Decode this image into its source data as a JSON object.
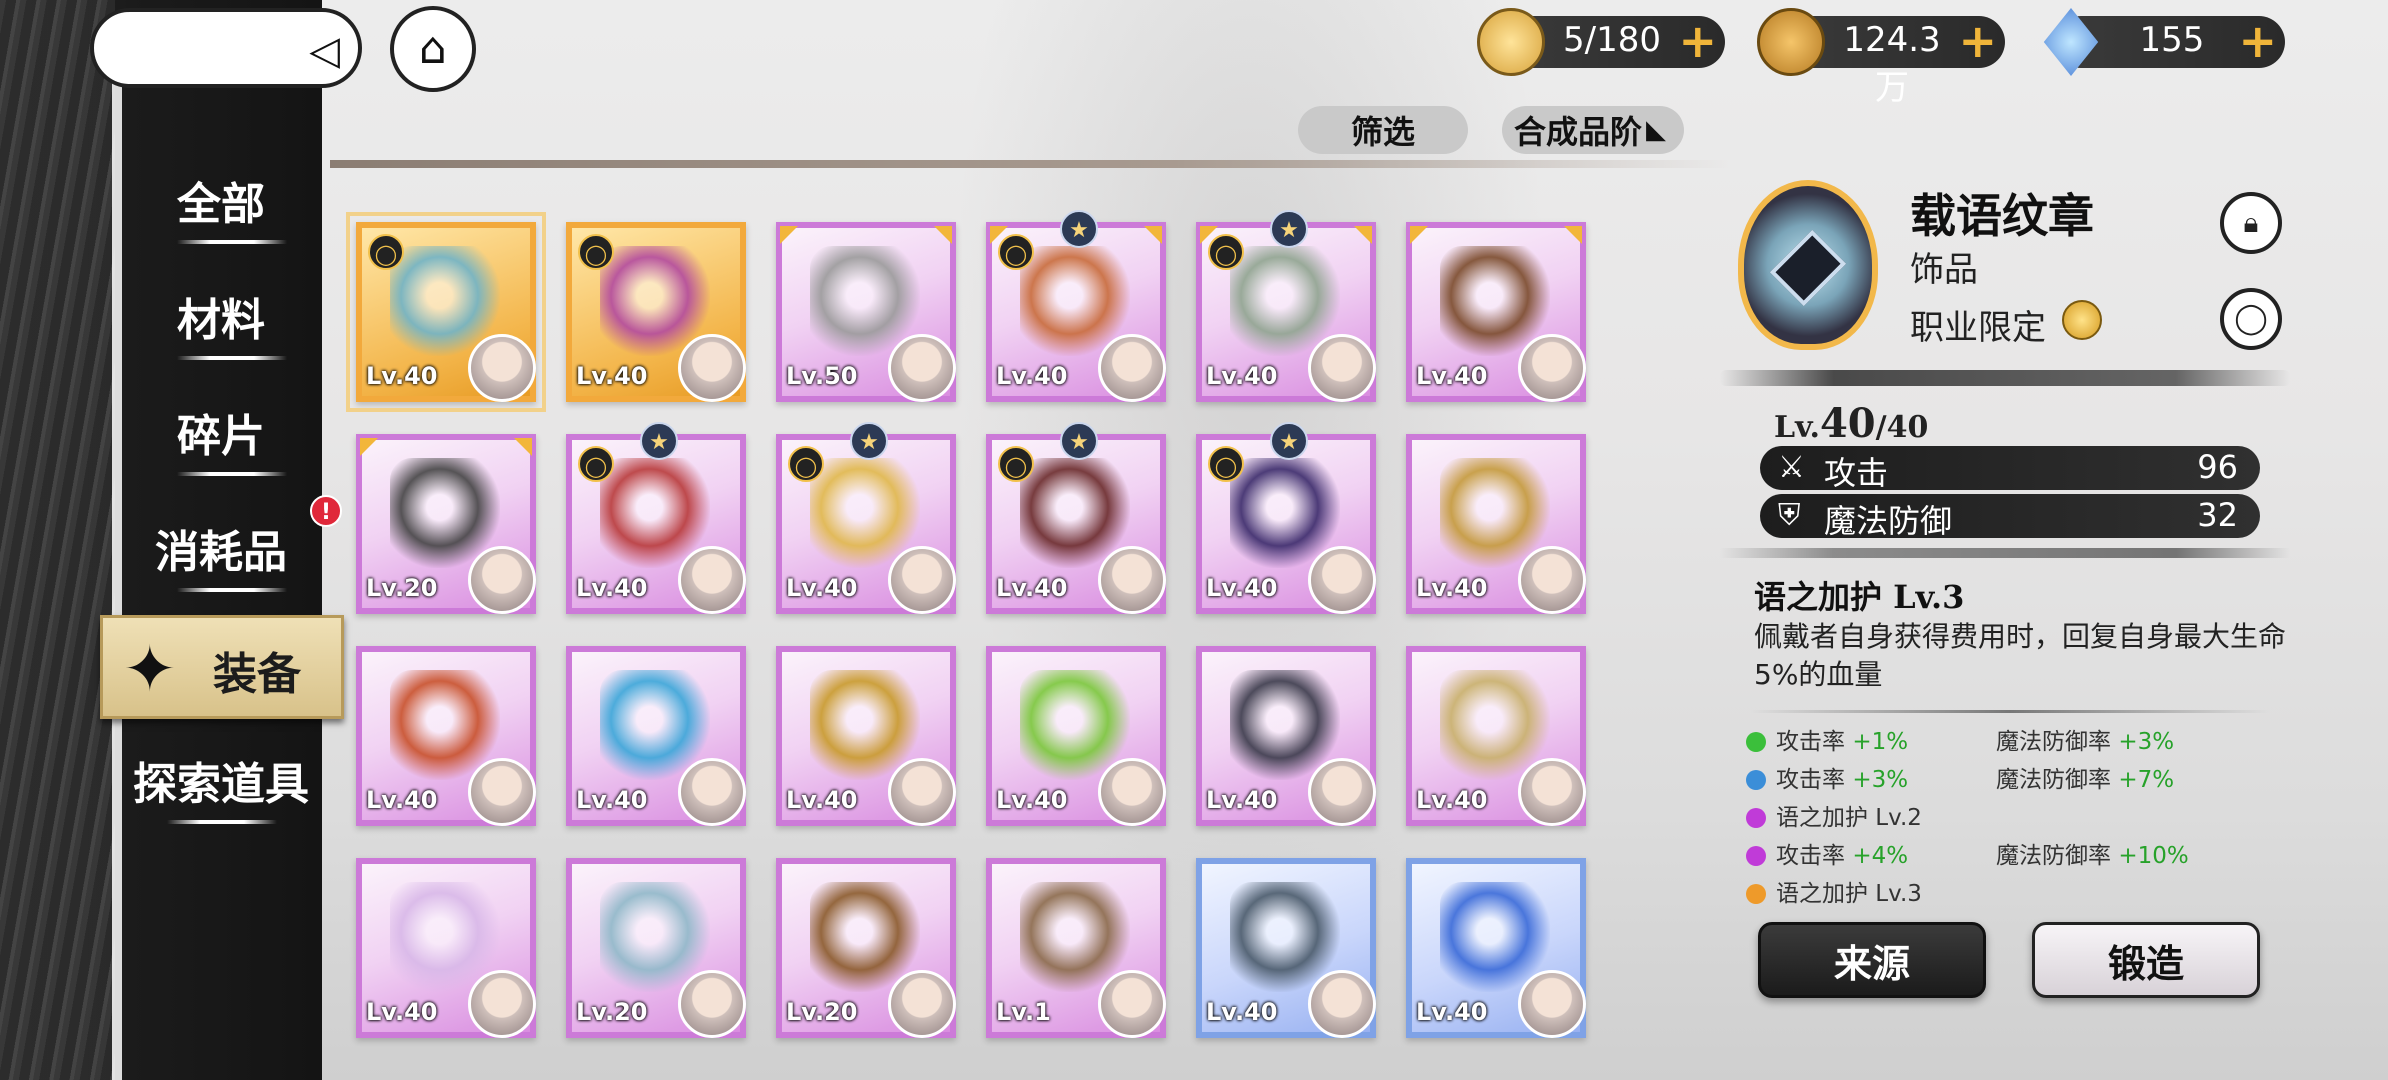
{
  "resources": [
    {
      "name": "stamina",
      "icon": "gold-ticket-icon",
      "value": "5/180",
      "color": "#e2b84a"
    },
    {
      "name": "gold",
      "icon": "gold-coin-icon",
      "value": "124.3万",
      "color": "#c98b2b"
    },
    {
      "name": "gem",
      "icon": "blue-crystal-icon",
      "value": "155",
      "color": "#4a86d8"
    }
  ],
  "sidebar": {
    "items": [
      {
        "label": "全部"
      },
      {
        "label": "材料"
      },
      {
        "label": "碎片"
      },
      {
        "label": "消耗品",
        "badge": "!"
      },
      {
        "label": "装备",
        "active": true
      },
      {
        "label": "探索道具"
      }
    ]
  },
  "filter": {
    "label": "筛选",
    "sort": "合成品阶"
  },
  "items": [
    {
      "lv": "Lv.40",
      "frame": "gold",
      "lock": true,
      "selected": true,
      "art": "#6fb3c8"
    },
    {
      "lv": "Lv.40",
      "frame": "gold",
      "lock": true,
      "art": "#b24aa0"
    },
    {
      "lv": "Lv.50",
      "frame": "purple",
      "corners": true,
      "art": "#9a9a9a"
    },
    {
      "lv": "Lv.40",
      "frame": "purple",
      "lock": true,
      "star": true,
      "corners": true,
      "art": "#c86b3a"
    },
    {
      "lv": "Lv.40",
      "frame": "purple",
      "lock": true,
      "star": true,
      "corners": true,
      "art": "#8fa48f"
    },
    {
      "lv": "Lv.40",
      "frame": "purple",
      "corners": true,
      "art": "#7a4a2a"
    },
    {
      "lv": "Lv.20",
      "frame": "purple",
      "corners": true,
      "art": "#444444"
    },
    {
      "lv": "Lv.40",
      "frame": "purple",
      "lock": true,
      "star": true,
      "art": "#b83a3a"
    },
    {
      "lv": "Lv.40",
      "frame": "purple",
      "lock": true,
      "star": true,
      "art": "#e0b84a"
    },
    {
      "lv": "Lv.40",
      "frame": "purple",
      "lock": true,
      "star": true,
      "art": "#6a2a2a"
    },
    {
      "lv": "Lv.40",
      "frame": "purple",
      "lock": true,
      "star": true,
      "art": "#3a2a6a"
    },
    {
      "lv": "Lv.40",
      "frame": "purple",
      "art": "#c49a3a"
    },
    {
      "lv": "Lv.40",
      "frame": "purple",
      "art": "#c8502a"
    },
    {
      "lv": "Lv.40",
      "frame": "purple",
      "art": "#3aa6d8"
    },
    {
      "lv": "Lv.40",
      "frame": "purple",
      "art": "#c89a2a"
    },
    {
      "lv": "Lv.40",
      "frame": "purple",
      "art": "#7ac83a"
    },
    {
      "lv": "Lv.40",
      "frame": "purple",
      "art": "#3a3a4a"
    },
    {
      "lv": "Lv.40",
      "frame": "purple",
      "art": "#c8b06a"
    },
    {
      "lv": "Lv.40",
      "frame": "purple",
      "art": "#d8b8e8"
    },
    {
      "lv": "Lv.20",
      "frame": "purple",
      "art": "#8fb8c8"
    },
    {
      "lv": "Lv.20",
      "frame": "purple",
      "art": "#8a5a2a"
    },
    {
      "lv": "Lv.1",
      "frame": "purple",
      "art": "#8a6a4a"
    },
    {
      "lv": "Lv.40",
      "frame": "blue",
      "art": "#4a5a6a"
    },
    {
      "lv": "Lv.40",
      "frame": "blue",
      "art": "#3a6ad8"
    }
  ],
  "detail": {
    "name": "载语纹章",
    "type": "饰品",
    "class_limit": "职业限定",
    "level_prefix": "Lv.",
    "level_current": "40",
    "level_max": "/40",
    "stats": [
      {
        "icon": "crossed-swords-icon",
        "name": "攻击",
        "value": "96"
      },
      {
        "icon": "shield-icon",
        "name": "魔法防御",
        "value": "32"
      }
    ],
    "skill_name": "语之加护 Lv.3",
    "skill_desc": "佩戴者自身获得费用时，回复自身最大生命5%的血量",
    "substats": [
      {
        "dot": "#3bbf3b",
        "left": "攻击率",
        "left_val": "+1%",
        "right": "魔法防御率",
        "right_val": "+3%"
      },
      {
        "dot": "#3b8ed8",
        "left": "攻击率",
        "left_val": "+3%",
        "right": "魔法防御率",
        "right_val": "+7%"
      },
      {
        "dot": "#c03bd8",
        "left": "语之加护 Lv.2",
        "left_val": "",
        "right": "",
        "right_val": ""
      },
      {
        "dot": "#c03bd8",
        "left": "攻击率",
        "left_val": "+4%",
        "right": "魔法防御率",
        "right_val": "+10%"
      },
      {
        "dot": "#ee9a2a",
        "left": "语之加护 Lv.3",
        "left_val": "",
        "right": "",
        "right_val": ""
      }
    ],
    "btn_source": "来源",
    "btn_forge": "锻造"
  }
}
